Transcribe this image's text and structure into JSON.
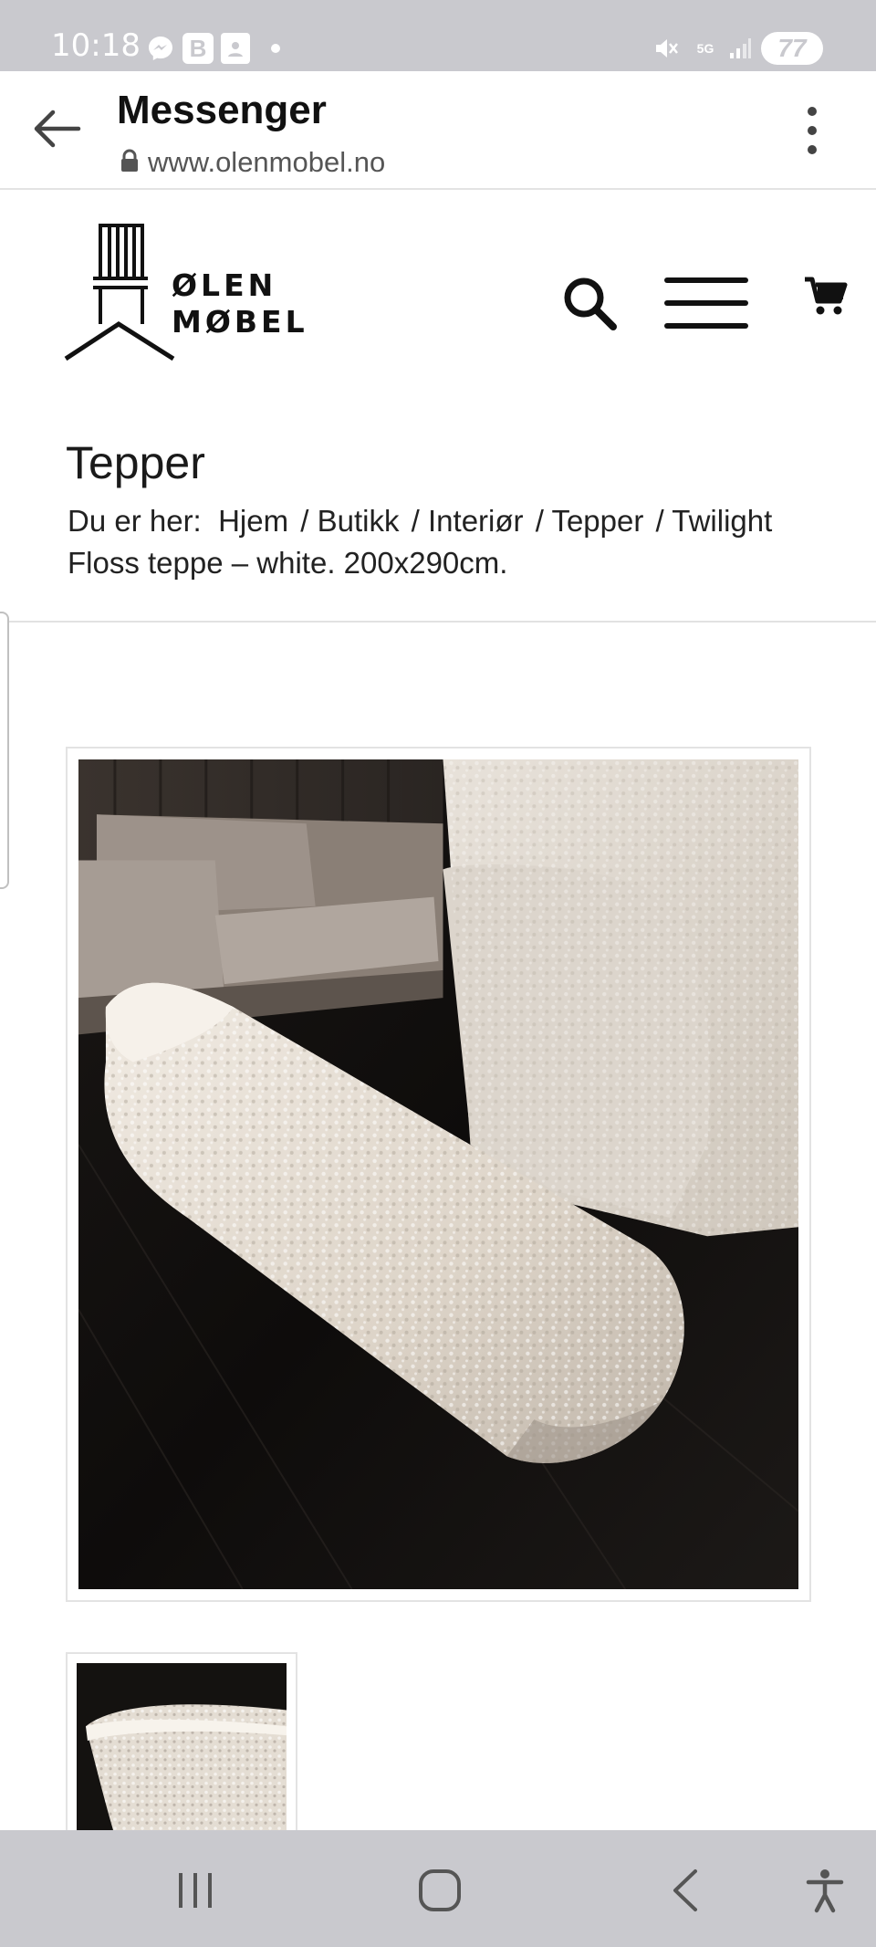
{
  "status_bar": {
    "time": "10:18",
    "b_badge": "B",
    "network": "5G",
    "battery": "77",
    "icons": [
      "messenger-icon",
      "b-icon",
      "contact-icon",
      "dot-icon",
      "mute-icon",
      "5g-icon",
      "signal-icon",
      "battery-icon"
    ]
  },
  "browser": {
    "title": "Messenger",
    "url": "www.olenmobel.no",
    "icons": [
      "back-arrow-icon",
      "lock-icon",
      "more-vert-icon"
    ]
  },
  "site": {
    "logo_line1": "ØLEN",
    "logo_line2": "MØBEL",
    "icons": [
      "search-icon",
      "hamburger-menu-icon",
      "cart-icon"
    ]
  },
  "page": {
    "title": "Tepper",
    "breadcrumb": {
      "prefix": "Du er her:",
      "items": [
        "Hjem",
        "Butikk",
        "Interiør",
        "Tepper"
      ],
      "separator": "/",
      "current": "Twilight Floss teppe – white. 200x290cm."
    }
  },
  "product": {
    "main_image_alt": "rolled white shaggy rug",
    "thumb_image_alt": "white shaggy rug thumbnail"
  },
  "nav_bar": {
    "icons": [
      "recents-icon",
      "home-icon",
      "back-icon",
      "accessibility-icon"
    ]
  },
  "colors": {
    "status_bar_bg": "#c9c9ce",
    "nav_bar_bg": "#c9c9ce",
    "text": "#111111",
    "divider": "#e2e2e2"
  }
}
